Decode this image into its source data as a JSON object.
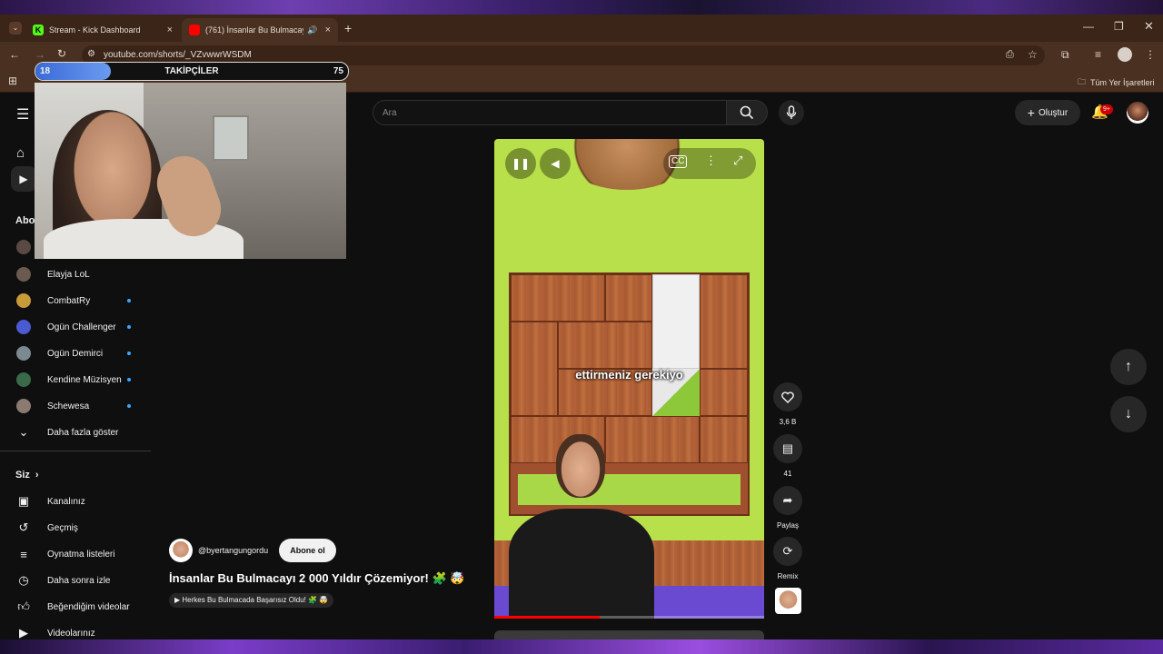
{
  "browser": {
    "tabs": [
      {
        "title": "Stream - Kick Dashboard",
        "active": false
      },
      {
        "title": "(761) İnsanlar Bu Bulmacayı",
        "active": true
      }
    ],
    "url": "youtube.com/shorts/_VZvwwrWSDM",
    "bookmarks_label": "Tüm Yer İşaretleri"
  },
  "overlay": {
    "followers_current": "18",
    "followers_label": "TAKİPÇİLER",
    "followers_goal": "75",
    "progress_fraction": 0.24
  },
  "youtube": {
    "search_placeholder": "Ara",
    "create_label": "Oluştur",
    "notification_badge": "9+",
    "sidebar": {
      "section_subs_partial": "Abo",
      "subscriptions": [
        {
          "name": "Elayja LoL",
          "new": false,
          "color": "#6a5a50"
        },
        {
          "name": "CombatRy",
          "new": true,
          "color": "#c89a3a"
        },
        {
          "name": "Ogün Challenger",
          "new": true,
          "color": "#4a5ad0"
        },
        {
          "name": "Ogün Demirci",
          "new": true,
          "color": "#7a8a90"
        },
        {
          "name": "Kendine Müzisyen",
          "new": true,
          "color": "#3a6a4a"
        },
        {
          "name": "Schewesa",
          "new": true,
          "color": "#8a7a70"
        }
      ],
      "show_more": "Daha fazla göster",
      "you_section": "Siz",
      "you_items": [
        {
          "label": "Kanalınız",
          "icon": "channel-icon"
        },
        {
          "label": "Geçmiş",
          "icon": "history-icon"
        },
        {
          "label": "Oynatma listeleri",
          "icon": "playlist-icon"
        },
        {
          "label": "Daha sonra izle",
          "icon": "clock-icon"
        },
        {
          "label": "Beğendiğim videolar",
          "icon": "thumbs-up-icon"
        },
        {
          "label": "Videolarınız",
          "icon": "video-icon"
        }
      ]
    },
    "short": {
      "channel": "@byertangungordu",
      "subscribe_label": "Abone ol",
      "title": "İnsanlar Bu Bulmacayı 2 000 Yıldır Çözemiyor! 🧩 🤯",
      "related_chip": "▶ Herkes Bu Bulmacada Başarısız Oldu! 🧩 🤯",
      "caption": "ettirmeniz gerekiyo",
      "likes": "3,6 B",
      "comments": "41",
      "share_label": "Paylaş",
      "remix_label": "Remix",
      "progress_fraction": 0.39
    }
  }
}
